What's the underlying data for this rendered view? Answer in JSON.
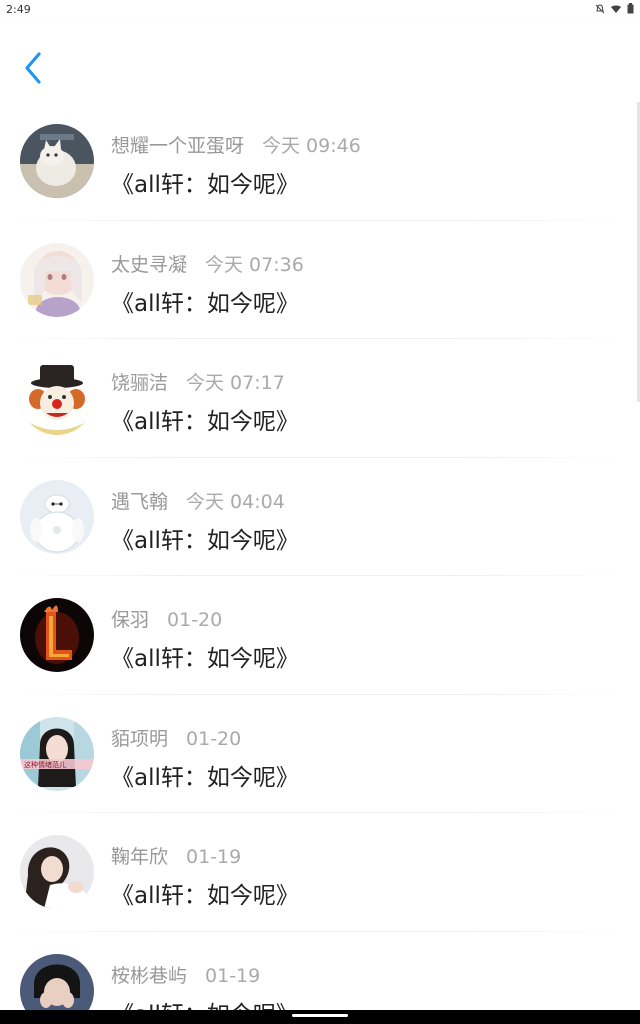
{
  "status_bar": {
    "time": "2:49",
    "icons": [
      "bell-off-icon",
      "wifi-icon",
      "battery-icon"
    ]
  },
  "app_bar": {
    "back_icon": "chevron-left-icon",
    "accent_color": "#2196f3"
  },
  "conversations": [
    {
      "name": "想耀一个亚蛋呀",
      "time": "今天 09:46",
      "message": "《all轩：如今呢》",
      "avatar": "cat-avatar"
    },
    {
      "name": "太史寻凝",
      "time": "今天 07:36",
      "message": "《all轩：如今呢》",
      "avatar": "anime-girl-avatar"
    },
    {
      "name": "饶骊洁",
      "time": "今天 07:17",
      "message": "《all轩：如今呢》",
      "avatar": "clown-avatar"
    },
    {
      "name": "遇飞翰",
      "time": "今天 04:04",
      "message": "《all轩：如今呢》",
      "avatar": "baymax-avatar"
    },
    {
      "name": "保羽",
      "time": "01-20",
      "message": "《all轩：如今呢》",
      "avatar": "fire-letter-l-avatar"
    },
    {
      "name": "貊项明",
      "time": "01-20",
      "message": "《all轩：如今呢》",
      "avatar": "girl-photo-avatar"
    },
    {
      "name": "鞠年欣",
      "time": "01-19",
      "message": "《all轩：如今呢》",
      "avatar": "woman-photo-avatar"
    },
    {
      "name": "桉彬巷屿",
      "time": "01-19",
      "message": "《all轩：如今呢》",
      "avatar": "person-photo-avatar"
    }
  ]
}
